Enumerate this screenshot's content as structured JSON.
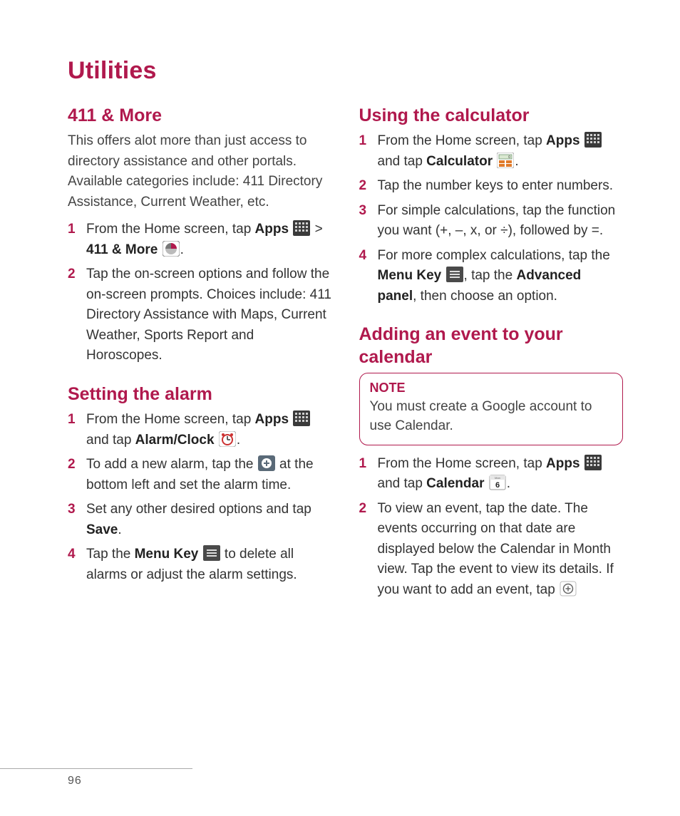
{
  "page": {
    "title": "Utilities",
    "number": "96"
  },
  "left": {
    "section1": {
      "heading": "411 & More",
      "intro": "This offers alot more than just access to directory assistance and other portals. Available categories include: 411 Directory Assistance, Current Weather, etc.",
      "s1_a": "From the Home screen, tap ",
      "s1_apps": "Apps",
      "s1_b": " > ",
      "s1_411": "411 & More",
      "s1_c": ".",
      "s2": "Tap the on-screen options and follow the on-screen prompts. Choices include: 411 Directory Assistance with Maps, Current Weather, Sports Report and Horoscopes."
    },
    "section2": {
      "heading": "Setting the alarm",
      "s1_a": "From the Home screen, tap ",
      "s1_apps": "Apps",
      "s1_b": " and tap ",
      "s1_alarm": "Alarm/Clock",
      "s1_c": ".",
      "s2_a": "To add a new alarm, tap the ",
      "s2_b": " at the bottom left and set the alarm time.",
      "s3_a": "Set any other desired options and tap ",
      "s3_save": "Save",
      "s3_b": ".",
      "s4_a": "Tap the ",
      "s4_menu": "Menu Key",
      "s4_b": " to delete all alarms or adjust the alarm settings."
    }
  },
  "right": {
    "section1": {
      "heading": "Using the calculator",
      "s1_a": "From the Home screen, tap ",
      "s1_apps": "Apps",
      "s1_b": " and tap ",
      "s1_calc": "Calculator",
      "s1_c": ".",
      "s2": "Tap the number keys to enter numbers.",
      "s3": "For simple calculations, tap the function you want (+, –, x, or ÷), followed by =.",
      "s4_a": "For more complex calculations, tap the ",
      "s4_menu": "Menu Key",
      "s4_b": ", tap the ",
      "s4_adv": "Advanced panel",
      "s4_c": ", then choose an option."
    },
    "section2": {
      "heading": "Adding an event to your calendar",
      "note_title": "NOTE",
      "note_body": "You must create a Google account to use Calendar.",
      "s1_a": "From the Home screen, tap ",
      "s1_apps": "Apps",
      "s1_b": " and tap ",
      "s1_cal": "Calendar",
      "s1_c": ".",
      "s2_a": "To view an event, tap the date. The events occurring on that date are displayed below the Calendar in Month view. Tap the event to view its details. If you want to add an event, tap "
    }
  }
}
